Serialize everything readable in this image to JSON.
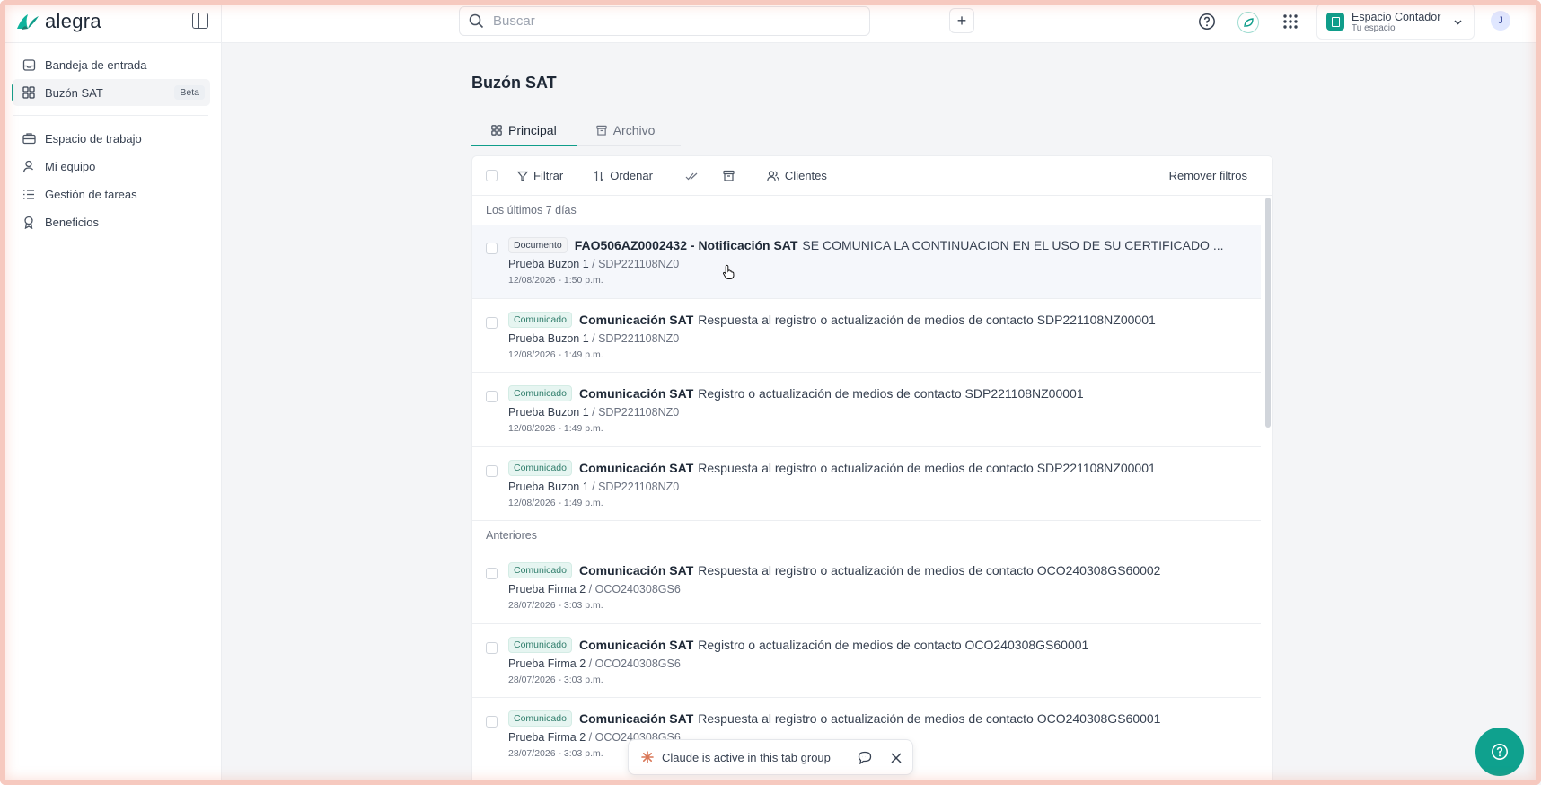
{
  "brand": {
    "name": "alegra"
  },
  "header": {
    "search_placeholder": "Buscar",
    "add_label": "+",
    "workspace": {
      "name": "Espacio Contador",
      "subtitle": "Tu espacio"
    },
    "avatar_initial": "J"
  },
  "sidebar": {
    "items": [
      {
        "label": "Bandeja de entrada",
        "icon": "inbox-icon"
      },
      {
        "label": "Buzón SAT",
        "icon": "grid-icon",
        "badge": "Beta",
        "active": true
      },
      {
        "label": "Espacio de trabajo",
        "icon": "briefcase-icon"
      },
      {
        "label": "Mi equipo",
        "icon": "user-icon"
      },
      {
        "label": "Gestión de tareas",
        "icon": "tasks-icon"
      },
      {
        "label": "Beneficios",
        "icon": "award-icon"
      }
    ]
  },
  "main": {
    "title": "Buzón SAT",
    "tabs": [
      {
        "label": "Principal",
        "active": true
      },
      {
        "label": "Archivo",
        "active": false
      }
    ],
    "toolbar": {
      "filter": "Filtrar",
      "sort": "Ordenar",
      "clients": "Clientes",
      "remove_filters": "Remover filtros"
    },
    "sections": [
      {
        "label": "Los últimos 7 días",
        "rows": [
          {
            "badge": "Documento",
            "badge_type": "doc",
            "title": "FAO506AZ0002432 - Notificación SAT",
            "desc": "SE COMUNICA LA CONTINUACION EN EL USO DE SU CERTIFICADO ...",
            "client": "Prueba Buzon 1",
            "code": "SDP221108NZ0",
            "date": "12/08/2026 - 1:50 p.m.",
            "hover": true
          },
          {
            "badge": "Comunicado",
            "badge_type": "com",
            "title": "Comunicación SAT",
            "desc": "Respuesta al registro o actualización de medios de contacto SDP221108NZ00001",
            "client": "Prueba Buzon 1",
            "code": "SDP221108NZ0",
            "date": "12/08/2026 - 1:49 p.m."
          },
          {
            "badge": "Comunicado",
            "badge_type": "com",
            "title": "Comunicación SAT",
            "desc": "Registro o actualización de medios de contacto SDP221108NZ00001",
            "client": "Prueba Buzon 1",
            "code": "SDP221108NZ0",
            "date": "12/08/2026 - 1:49 p.m."
          },
          {
            "badge": "Comunicado",
            "badge_type": "com",
            "title": "Comunicación SAT",
            "desc": "Respuesta al registro o actualización de medios de contacto SDP221108NZ00001",
            "client": "Prueba Buzon 1",
            "code": "SDP221108NZ0",
            "date": "12/08/2026 - 1:49 p.m."
          }
        ]
      },
      {
        "label": "Anteriores",
        "rows": [
          {
            "badge": "Comunicado",
            "badge_type": "com",
            "title": "Comunicación SAT",
            "desc": "Respuesta al registro o actualización de medios de contacto OCO240308GS60002",
            "client": "Prueba Firma 2",
            "code": "OCO240308GS6",
            "date": "28/07/2026 - 3:03 p.m."
          },
          {
            "badge": "Comunicado",
            "badge_type": "com",
            "title": "Comunicación SAT",
            "desc": "Registro o actualización de medios de contacto OCO240308GS60001",
            "client": "Prueba Firma 2",
            "code": "OCO240308GS6",
            "date": "28/07/2026 - 3:03 p.m."
          },
          {
            "badge": "Comunicado",
            "badge_type": "com",
            "title": "Comunicación SAT",
            "desc": "Respuesta al registro o actualización de medios de contacto OCO240308GS60001",
            "client": "Prueba Firma 2",
            "code": "OCO240308GS6",
            "date": "28/07/2026 - 3:03 p.m."
          }
        ]
      }
    ]
  },
  "claude_bar": {
    "message": "Claude is active in this tab group"
  },
  "colors": {
    "accent": "#0f9d8a",
    "fab": "#0fa18e",
    "comunicado_bg": "#e6f5f1",
    "frame": "#f6c9bf"
  }
}
